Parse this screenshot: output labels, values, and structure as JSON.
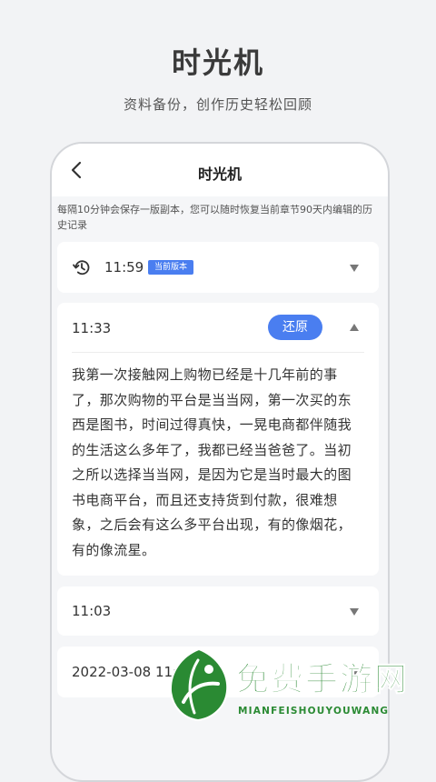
{
  "promo": {
    "title": "时光机",
    "subtitle": "资料备份，创作历史轻松回顾"
  },
  "nav": {
    "title": "时光机",
    "back_icon": "chevron-left-icon"
  },
  "hint": "每隔10分钟会保存一版副本，您可以随时恢复当前章节90天内编辑的历史记录",
  "versions": [
    {
      "time": "11:59",
      "badge": "当前版本",
      "icon": "history-icon",
      "state": "collapsed"
    },
    {
      "time": "11:33",
      "button": "还原",
      "state": "expanded",
      "content": "我第一次接触网上购物已经是十几年前的事了，那次购物的平台是当当网，第一次买的东西是图书，时间过得真快，一晃电商都伴随我的生活这么多年了，我都已经当爸爸了。当初之所以选择当当网，是因为它是当时最大的图书电商平台，而且还支持货到付款，很难想象，之后会有这么多平台出现，有的像烟花，有的像流星。"
    },
    {
      "time": "11:03",
      "state": "collapsed"
    },
    {
      "time": "2022-03-08 11:3",
      "state": "collapsed"
    }
  ],
  "watermark": {
    "title": "免费手游网",
    "subtitle": "MIANFEISHOUYOUWANG",
    "colors": {
      "green": "#2a8a33",
      "dark_green": "#1d6b26"
    }
  },
  "colors": {
    "accent": "#4a7ef0",
    "background": "#f2f3f5",
    "card": "#ffffff"
  }
}
